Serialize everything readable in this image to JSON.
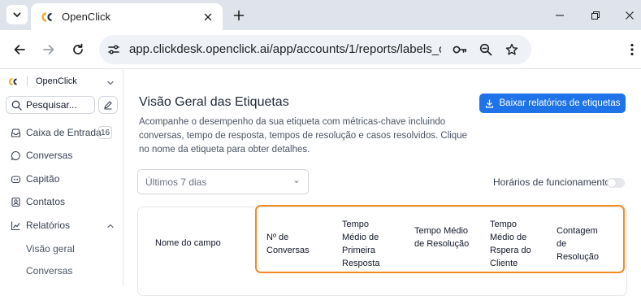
{
  "browser": {
    "tab_title": "OpenClick",
    "url": "app.clickdesk.openclick.ai/app/accounts/1/reports/labels_ov..."
  },
  "sidebar": {
    "brand": "OpenClick",
    "search_placeholder": "Pesquisar...",
    "items": [
      {
        "label": "Caixa de Entrada",
        "icon": "inbox-icon",
        "badge": "16"
      },
      {
        "label": "Conversas",
        "icon": "chat-bubble-icon"
      },
      {
        "label": "Capitão",
        "icon": "bot-icon"
      },
      {
        "label": "Contatos",
        "icon": "contact-card-icon"
      },
      {
        "label": "Relatórios",
        "icon": "chart-line-icon",
        "expanded": true
      }
    ],
    "sub_items": [
      "Visão geral",
      "Conversas"
    ]
  },
  "main": {
    "title": "Visão Geral das Etiquetas",
    "description": "Acompanhe o desempenho da sua etiqueta com métricas-chave incluindo conversas, tempo de resposta, tempos de resolução e casos resolvidos. Clique no nome da etiqueta para obter detalhes.",
    "download_label": "Baixar relatórios de etiquetas",
    "date_range": "Últimos 7 dias",
    "business_hours_label": "Horários de funcionamento",
    "business_hours_on": false,
    "table_headers": [
      "Nome do campo",
      "Nº de Conversas",
      "Tempo Médio de Primeira Resposta",
      "Tempo Médio de Resolução",
      "Tempo Médio de Rspera do Cliente",
      "Contagem de Resolução"
    ]
  },
  "colors": {
    "accent": "#1f73e8",
    "highlight": "#f58a23",
    "logo_orange": "#f5a623"
  }
}
